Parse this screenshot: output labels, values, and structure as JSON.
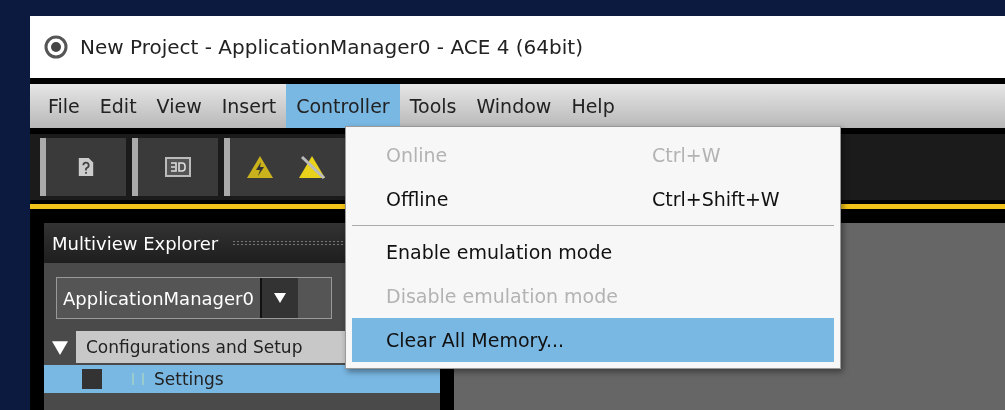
{
  "window": {
    "title": "New Project - ApplicationManager0 - ACE 4 (64bit)"
  },
  "menu_bar": [
    {
      "label": "File",
      "selected": false
    },
    {
      "label": "Edit",
      "selected": false
    },
    {
      "label": "View",
      "selected": false
    },
    {
      "label": "Insert",
      "selected": false
    },
    {
      "label": "Controller",
      "selected": true
    },
    {
      "label": "Tools",
      "selected": false
    },
    {
      "label": "Window",
      "selected": false
    },
    {
      "label": "Help",
      "selected": false
    }
  ],
  "controller_menu": [
    {
      "kind": "item",
      "label": "Online",
      "shortcut": "Ctrl+W",
      "disabled": true,
      "selected": false
    },
    {
      "kind": "item",
      "label": "Offline",
      "shortcut": "Ctrl+Shift+W",
      "disabled": false,
      "selected": false
    },
    {
      "kind": "separator"
    },
    {
      "kind": "item",
      "label": "Enable emulation mode",
      "disabled": false,
      "selected": false
    },
    {
      "kind": "item",
      "label": "Disable emulation mode",
      "disabled": true,
      "selected": false
    },
    {
      "kind": "item",
      "label": "Clear All Memory...",
      "disabled": false,
      "selected": true
    }
  ],
  "multiview_explorer": {
    "title": "Multiview Explorer",
    "dropdown": {
      "value": "ApplicationManager0"
    },
    "tree": [
      {
        "label": "Configurations and Setup",
        "expanded": true,
        "selected": false,
        "children": [
          {
            "label": "Settings",
            "selected": true
          }
        ]
      }
    ]
  }
}
